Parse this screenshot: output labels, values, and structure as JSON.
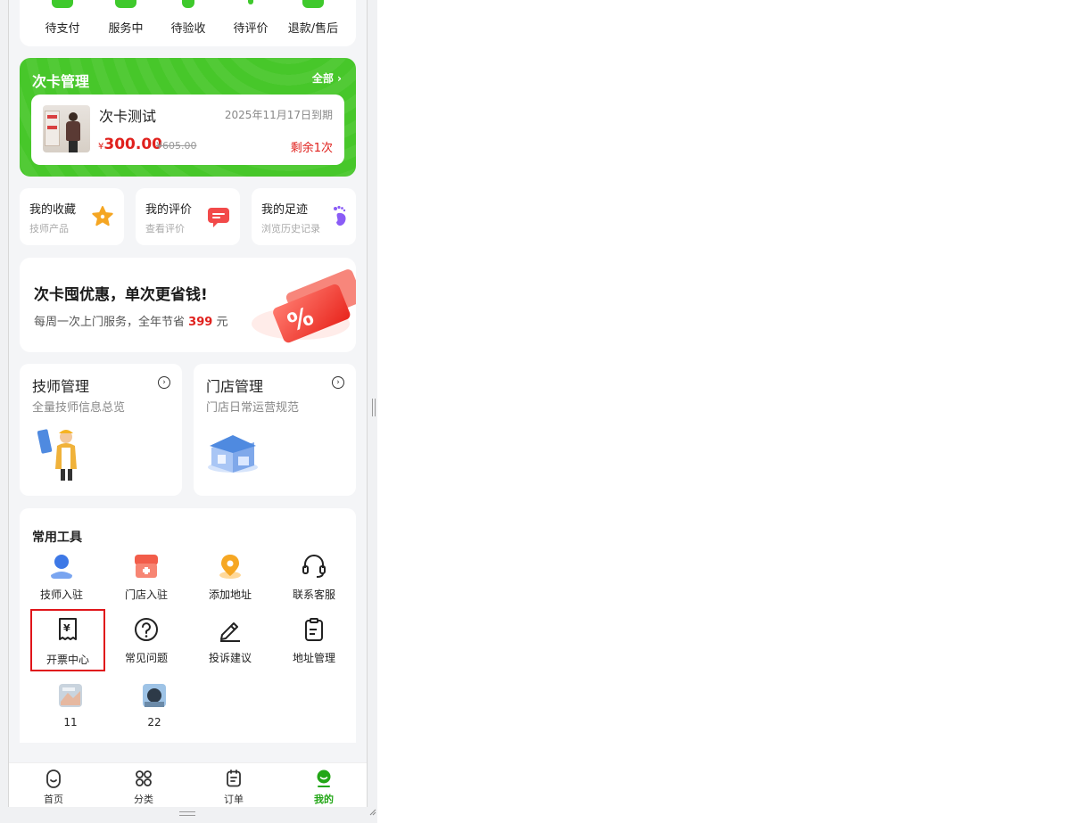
{
  "orders": {
    "items": [
      {
        "label": "待支付"
      },
      {
        "label": "服务中"
      },
      {
        "label": "待验收"
      },
      {
        "label": "待评价"
      },
      {
        "label": "退款/售后"
      }
    ]
  },
  "card_mgmt": {
    "title": "次卡管理",
    "all_label": "全部",
    "card": {
      "name": "次卡测试",
      "expiry": "2025年11月17日到期",
      "currency": "¥",
      "price": "300.00",
      "original_price": "¥605.00",
      "remaining": "剩余1次"
    }
  },
  "shortcuts": [
    {
      "title": "我的收藏",
      "sub": "技师产品",
      "icon": "star-icon",
      "color": "#f5a623"
    },
    {
      "title": "我的评价",
      "sub": "查看评价",
      "icon": "comment-icon",
      "color": "#f24a4a"
    },
    {
      "title": "我的足迹",
      "sub": "浏览历史记录",
      "icon": "footprint-icon",
      "color": "#8a5cf6"
    }
  ],
  "promo": {
    "headline": "次卡囤优惠，单次更省钱!",
    "desc_prefix": "每周一次上门服务，全年节省",
    "desc_amount": "399",
    "desc_suffix": "元"
  },
  "management": [
    {
      "title": "技师管理",
      "sub": "全量技师信息总览"
    },
    {
      "title": "门店管理",
      "sub": "门店日常运营规范"
    }
  ],
  "tools": {
    "title": "常用工具",
    "items": [
      {
        "label": "技师入驻",
        "icon": "technician-icon"
      },
      {
        "label": "门店入驻",
        "icon": "store-join-icon"
      },
      {
        "label": "添加地址",
        "icon": "location-icon"
      },
      {
        "label": "联系客服",
        "icon": "headset-icon"
      },
      {
        "label": "开票中心",
        "icon": "invoice-icon"
      },
      {
        "label": "常见问题",
        "icon": "question-icon"
      },
      {
        "label": "投诉建议",
        "icon": "edit-icon"
      },
      {
        "label": "地址管理",
        "icon": "clipboard-icon"
      },
      {
        "label": "11",
        "icon": "thumbnail-icon"
      },
      {
        "label": "22",
        "icon": "thumbnail-icon"
      }
    ]
  },
  "tabbar": {
    "items": [
      {
        "label": "首页",
        "icon": "home-icon"
      },
      {
        "label": "分类",
        "icon": "category-icon"
      },
      {
        "label": "订单",
        "icon": "order-icon"
      },
      {
        "label": "我的",
        "icon": "profile-icon"
      }
    ],
    "active_color": "#22a616"
  },
  "colors": {
    "brand_green": "#47c72a",
    "price_red": "#e0211d",
    "selection_outline": "#e0151a"
  }
}
